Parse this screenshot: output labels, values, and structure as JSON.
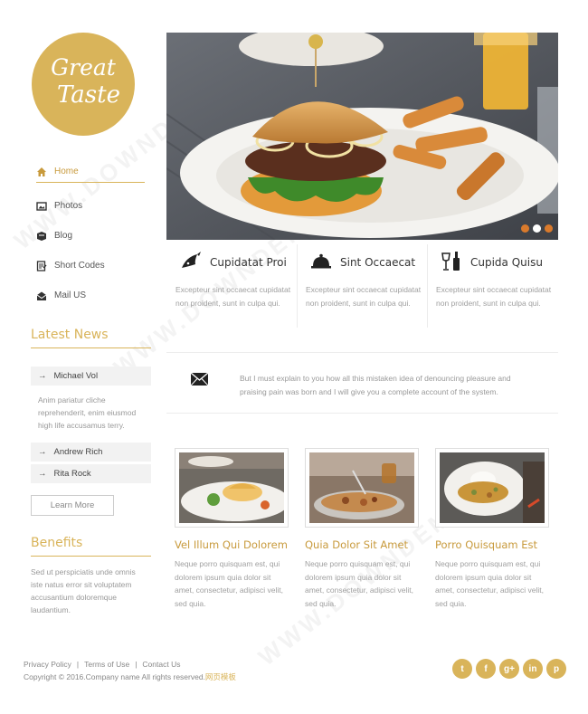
{
  "logo": {
    "line1": "Great",
    "line2": "Taste"
  },
  "nav": [
    {
      "label": "Home",
      "icon": "home-icon",
      "active": true
    },
    {
      "label": "Photos",
      "icon": "photos-icon"
    },
    {
      "label": "Blog",
      "icon": "blog-icon"
    },
    {
      "label": "Short Codes",
      "icon": "short-codes-icon"
    },
    {
      "label": "Mail US",
      "icon": "mail-us-icon"
    }
  ],
  "latest_news": {
    "title": "Latest News",
    "items": [
      {
        "name": "Michael Vol",
        "text": "Anim pariatur cliche reprehenderit, enim eiusmod high life accusamus terry."
      },
      {
        "name": "Andrew Rich"
      },
      {
        "name": "Rita Rock"
      }
    ],
    "button": "Learn More"
  },
  "benefits": {
    "title": "Benefits",
    "text": "Sed ut perspiciatis unde omnis iste natus error sit voluptatem accusantium doloremque laudantium."
  },
  "hero": {
    "slides": 3,
    "active_slide": 1
  },
  "features": [
    {
      "title": "Cupidatat Proi",
      "icon": "fish-icon",
      "text": "Excepteur sint occaecat cupidatat non proident, sunt in culpa qui."
    },
    {
      "title": "Sint Occaecat",
      "icon": "cloche-icon",
      "text": "Excepteur sint occaecat cupidatat non proident, sunt in culpa qui."
    },
    {
      "title": "Cupida Quisu",
      "icon": "wine-icon",
      "text": "Excepteur sint occaecat cupidatat non proident, sunt in culpa qui."
    }
  ],
  "quote": {
    "icon": "envelope-icon",
    "text": "But I must explain to you how all this mistaken idea of denouncing pleasure and praising pain was born and I will give you a complete account of the system."
  },
  "cards": [
    {
      "title": "Vel Illum Qui Dolorem",
      "text": "Neque porro quisquam est, qui dolorem ipsum quia dolor sit amet, consectetur, adipisci velit, sed quia."
    },
    {
      "title": "Quia Dolor Sit Amet",
      "text": "Neque porro quisquam est, qui dolorem ipsum quia dolor sit amet, consectetur, adipisci velit, sed quia."
    },
    {
      "title": "Porro Quisquam Est",
      "text": "Neque porro quisquam est, qui dolorem ipsum quia dolor sit amet, consectetur, adipisci velit, sed quia."
    }
  ],
  "footer": {
    "links": [
      "Privacy Policy",
      "Terms of Use",
      "Contact Us"
    ],
    "separator": "|",
    "copyright": "Copyright © 2016.Company name All rights reserved.",
    "copyright_link": "网页模板",
    "social": [
      {
        "glyph": "t",
        "icon": "twitter-icon"
      },
      {
        "glyph": "f",
        "icon": "facebook-icon"
      },
      {
        "glyph": "g+",
        "icon": "google-plus-icon"
      },
      {
        "glyph": "in",
        "icon": "linkedin-icon"
      },
      {
        "glyph": "p",
        "icon": "pinterest-icon"
      }
    ]
  },
  "watermark": "WWW.DOWNDEMO.COM",
  "colors": {
    "accent": "#d9b45a",
    "accent_dark": "#c89a3c",
    "dot": "#d97a2c"
  }
}
